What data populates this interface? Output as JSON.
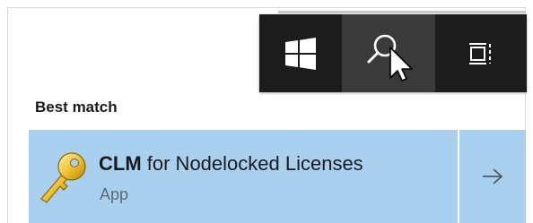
{
  "taskbar": {
    "start_icon": "windows-logo-icon",
    "search_icon": "search-icon",
    "task_view_icon": "task-view-icon"
  },
  "search_results": {
    "section_label": "Best match",
    "best_match": {
      "name_bold": "CLM",
      "name_rest": " for Nodelocked Licenses",
      "type": "App",
      "icon": "key-icon",
      "arrow_icon": "arrow-right-icon"
    }
  },
  "colors": {
    "taskbar_bg": "#1c1c1c",
    "search_button_hover": "#3a3a3a",
    "selection_bg": "#a9d1ef"
  }
}
